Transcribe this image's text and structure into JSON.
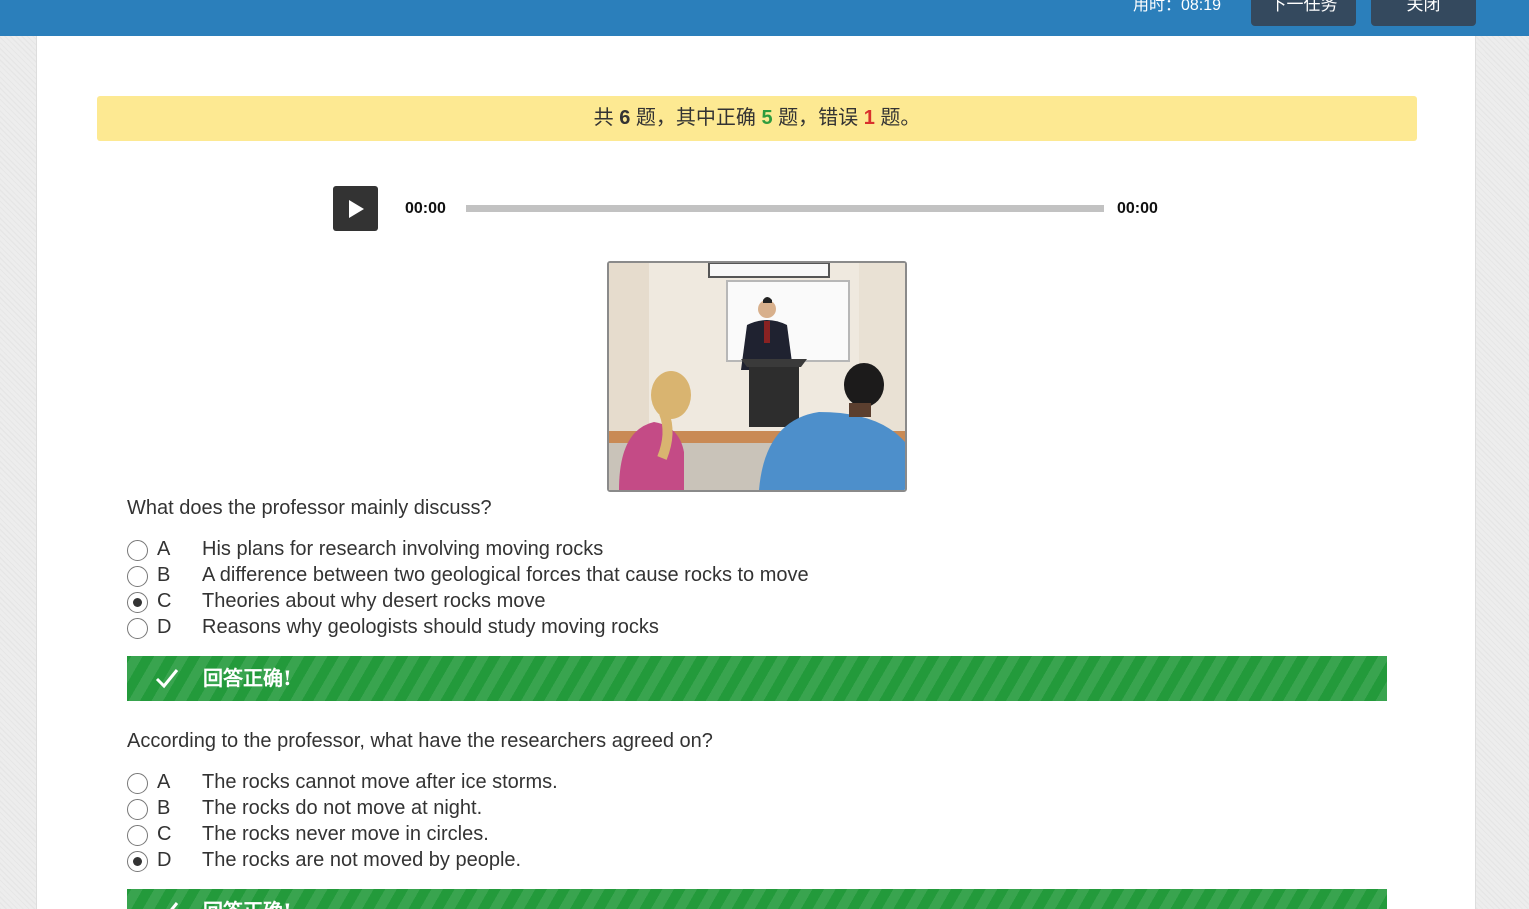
{
  "header": {
    "timer_label": "用时：08:19",
    "next_task_label": "下一任务",
    "close_label": "关闭",
    "bar_color": "#2b7fbb"
  },
  "summary": {
    "prefix": "共 ",
    "total": "6",
    "mid1": " 题，其中正确 ",
    "correct": "5",
    "mid2": " 题，错误 ",
    "wrong": "1",
    "suffix": " 题。"
  },
  "player": {
    "current_time": "00:00",
    "duration": "00:00",
    "progress_fraction": 0
  },
  "image": {
    "icon": "lecture-photo"
  },
  "questions": [
    {
      "text": "What does the professor mainly discuss?",
      "options": [
        {
          "letter": "A",
          "text": "His plans for research involving moving rocks",
          "selected": false
        },
        {
          "letter": "B",
          "text": "A difference between two geological forces that cause rocks to move",
          "selected": false
        },
        {
          "letter": "C",
          "text": "Theories about why desert rocks move",
          "selected": true
        },
        {
          "letter": "D",
          "text": "Reasons why geologists should study moving rocks",
          "selected": false
        }
      ],
      "result": "回答正确!"
    },
    {
      "text": "According to the professor, what have the researchers agreed on?",
      "options": [
        {
          "letter": "A",
          "text": "The rocks cannot move after ice storms.",
          "selected": false
        },
        {
          "letter": "B",
          "text": "The rocks do not move at night.",
          "selected": false
        },
        {
          "letter": "C",
          "text": "The rocks never move in circles.",
          "selected": false
        },
        {
          "letter": "D",
          "text": "The rocks are not moved by people.",
          "selected": true
        }
      ],
      "result": "回答正确!"
    }
  ],
  "colors": {
    "summary_bg": "#fde992",
    "correct_count": "#2e9b3e",
    "wrong_count": "#d9302c",
    "result_green": "#239a3b"
  }
}
